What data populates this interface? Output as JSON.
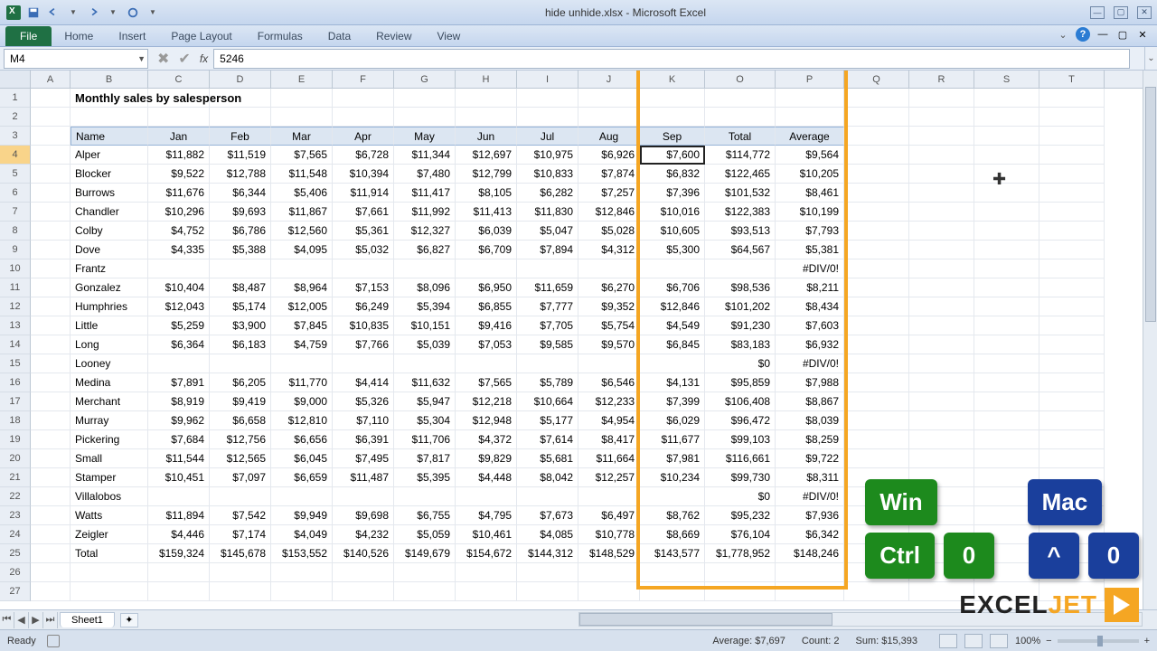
{
  "window": {
    "title": "hide unhide.xlsx - Microsoft Excel"
  },
  "ribbon": {
    "file": "File",
    "tabs": [
      "Home",
      "Insert",
      "Page Layout",
      "Formulas",
      "Data",
      "Review",
      "View"
    ]
  },
  "namebox": "M4",
  "formula": "5246",
  "columns": [
    {
      "l": "A",
      "w": 44
    },
    {
      "l": "B",
      "w": 86
    },
    {
      "l": "C",
      "w": 68
    },
    {
      "l": "D",
      "w": 68
    },
    {
      "l": "E",
      "w": 68
    },
    {
      "l": "F",
      "w": 68
    },
    {
      "l": "G",
      "w": 68
    },
    {
      "l": "H",
      "w": 68
    },
    {
      "l": "I",
      "w": 68
    },
    {
      "l": "J",
      "w": 68
    },
    {
      "l": "K",
      "w": 72
    },
    {
      "l": "O",
      "w": 78
    },
    {
      "l": "P",
      "w": 76
    },
    {
      "l": "Q",
      "w": 72
    },
    {
      "l": "R",
      "w": 72
    },
    {
      "l": "S",
      "w": 72
    },
    {
      "l": "T",
      "w": 72
    }
  ],
  "highlight": {
    "cols": [
      "K",
      "O",
      "P"
    ]
  },
  "title_cell": "Monthly sales by salesperson",
  "headers": [
    "Name",
    "Jan",
    "Feb",
    "Mar",
    "Apr",
    "May",
    "Jun",
    "Jul",
    "Aug",
    "Sep",
    "Total",
    "Average"
  ],
  "rows_data": [
    [
      "Alper",
      "$11,882",
      "$11,519",
      "$7,565",
      "$6,728",
      "$11,344",
      "$12,697",
      "$10,975",
      "$6,926",
      "$7,600",
      "$114,772",
      "$9,564"
    ],
    [
      "Blocker",
      "$9,522",
      "$12,788",
      "$11,548",
      "$10,394",
      "$7,480",
      "$12,799",
      "$10,833",
      "$7,874",
      "$6,832",
      "$122,465",
      "$10,205"
    ],
    [
      "Burrows",
      "$11,676",
      "$6,344",
      "$5,406",
      "$11,914",
      "$11,417",
      "$8,105",
      "$6,282",
      "$7,257",
      "$7,396",
      "$101,532",
      "$8,461"
    ],
    [
      "Chandler",
      "$10,296",
      "$9,693",
      "$11,867",
      "$7,661",
      "$11,992",
      "$11,413",
      "$11,830",
      "$12,846",
      "$10,016",
      "$122,383",
      "$10,199"
    ],
    [
      "Colby",
      "$4,752",
      "$6,786",
      "$12,560",
      "$5,361",
      "$12,327",
      "$6,039",
      "$5,047",
      "$5,028",
      "$10,605",
      "$93,513",
      "$7,793"
    ],
    [
      "Dove",
      "$4,335",
      "$5,388",
      "$4,095",
      "$5,032",
      "$6,827",
      "$6,709",
      "$7,894",
      "$4,312",
      "$5,300",
      "$64,567",
      "$5,381"
    ],
    [
      "Frantz",
      "",
      "",
      "",
      "",
      "",
      "",
      "",
      "",
      "",
      "",
      "#DIV/0!"
    ],
    [
      "Gonzalez",
      "$10,404",
      "$8,487",
      "$8,964",
      "$7,153",
      "$8,096",
      "$6,950",
      "$11,659",
      "$6,270",
      "$6,706",
      "$98,536",
      "$8,211"
    ],
    [
      "Humphries",
      "$12,043",
      "$5,174",
      "$12,005",
      "$6,249",
      "$5,394",
      "$6,855",
      "$7,777",
      "$9,352",
      "$12,846",
      "$101,202",
      "$8,434"
    ],
    [
      "Little",
      "$5,259",
      "$3,900",
      "$7,845",
      "$10,835",
      "$10,151",
      "$9,416",
      "$7,705",
      "$5,754",
      "$4,549",
      "$91,230",
      "$7,603"
    ],
    [
      "Long",
      "$6,364",
      "$6,183",
      "$4,759",
      "$7,766",
      "$5,039",
      "$7,053",
      "$9,585",
      "$9,570",
      "$6,845",
      "$83,183",
      "$6,932"
    ],
    [
      "Looney",
      "",
      "",
      "",
      "",
      "",
      "",
      "",
      "",
      "",
      "$0",
      "#DIV/0!"
    ],
    [
      "Medina",
      "$7,891",
      "$6,205",
      "$11,770",
      "$4,414",
      "$11,632",
      "$7,565",
      "$5,789",
      "$6,546",
      "$4,131",
      "$95,859",
      "$7,988"
    ],
    [
      "Merchant",
      "$8,919",
      "$9,419",
      "$9,000",
      "$5,326",
      "$5,947",
      "$12,218",
      "$10,664",
      "$12,233",
      "$7,399",
      "$106,408",
      "$8,867"
    ],
    [
      "Murray",
      "$9,962",
      "$6,658",
      "$12,810",
      "$7,110",
      "$5,304",
      "$12,948",
      "$5,177",
      "$4,954",
      "$6,029",
      "$96,472",
      "$8,039"
    ],
    [
      "Pickering",
      "$7,684",
      "$12,756",
      "$6,656",
      "$6,391",
      "$11,706",
      "$4,372",
      "$7,614",
      "$8,417",
      "$11,677",
      "$99,103",
      "$8,259"
    ],
    [
      "Small",
      "$11,544",
      "$12,565",
      "$6,045",
      "$7,495",
      "$7,817",
      "$9,829",
      "$5,681",
      "$11,664",
      "$7,981",
      "$116,661",
      "$9,722"
    ],
    [
      "Stamper",
      "$10,451",
      "$7,097",
      "$6,659",
      "$11,487",
      "$5,395",
      "$4,448",
      "$8,042",
      "$12,257",
      "$10,234",
      "$99,730",
      "$8,311"
    ],
    [
      "Villalobos",
      "",
      "",
      "",
      "",
      "",
      "",
      "",
      "",
      "",
      "$0",
      "#DIV/0!"
    ],
    [
      "Watts",
      "$11,894",
      "$7,542",
      "$9,949",
      "$9,698",
      "$6,755",
      "$4,795",
      "$7,673",
      "$6,497",
      "$8,762",
      "$95,232",
      "$7,936"
    ],
    [
      "Zeigler",
      "$4,446",
      "$7,174",
      "$4,049",
      "$4,232",
      "$5,059",
      "$10,461",
      "$4,085",
      "$10,778",
      "$8,669",
      "$76,104",
      "$6,342"
    ],
    [
      "Total",
      "$159,324",
      "$145,678",
      "$153,552",
      "$140,526",
      "$149,679",
      "$154,672",
      "$144,312",
      "$148,529",
      "$143,577",
      "$1,778,952",
      "$148,246"
    ]
  ],
  "row_numbers": [
    1,
    2,
    3,
    4,
    5,
    6,
    7,
    8,
    9,
    10,
    11,
    12,
    13,
    14,
    15,
    16,
    17,
    18,
    19,
    20,
    21,
    22,
    23,
    24,
    25,
    26,
    27
  ],
  "active": {
    "row": 4,
    "col": "K"
  },
  "sheets": {
    "active": "Sheet1"
  },
  "status": {
    "ready": "Ready",
    "average": "Average: $7,697",
    "count": "Count: 2",
    "sum": "Sum: $15,393",
    "zoom": "100%"
  },
  "keys": {
    "win": "Win",
    "mac": "Mac",
    "ctrl": "Ctrl",
    "zero": "0",
    "caret": "^",
    "zero2": "0"
  },
  "brand": {
    "excel": "EXCEL",
    "jet": "JET"
  }
}
